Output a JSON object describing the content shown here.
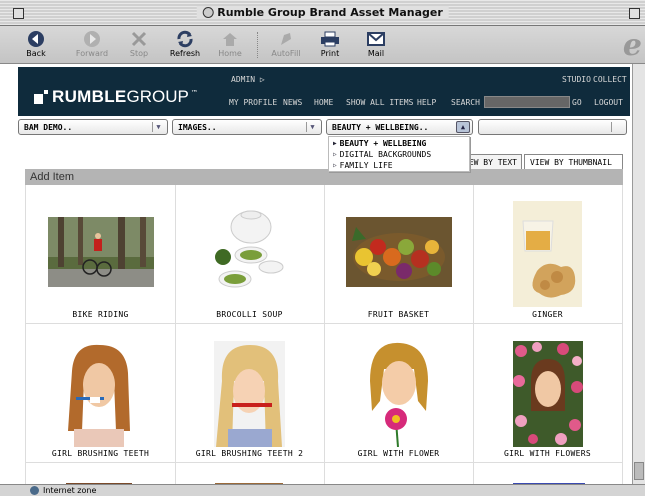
{
  "window": {
    "title": "Rumble Group Brand Asset Manager"
  },
  "toolbar": {
    "buttons": [
      {
        "label": "Back",
        "icon": "back-arrow-icon"
      },
      {
        "label": "Forward",
        "icon": "forward-arrow-icon"
      },
      {
        "label": "Stop",
        "icon": "stop-x-icon"
      },
      {
        "label": "Refresh",
        "icon": "refresh-icon"
      },
      {
        "label": "Home",
        "icon": "home-icon"
      },
      {
        "label": "AutoFill",
        "icon": "autofill-icon"
      },
      {
        "label": "Print",
        "icon": "printer-icon"
      },
      {
        "label": "Mail",
        "icon": "mail-icon"
      }
    ]
  },
  "header": {
    "logo_bold": "RUMBLE",
    "logo_light": "GROUP",
    "logo_tm": "™",
    "admin": "ADMIN",
    "nav": {
      "studio": "STUDIO",
      "collect": "COLLECT",
      "my_profile": "MY PROFILE",
      "news": "NEWS",
      "home": "HOME",
      "show_all": "SHOW ALL ITEMS",
      "help": "HELP",
      "search": "SEARCH",
      "go": "GO",
      "logout": "LOGOUT"
    }
  },
  "filters": {
    "client": "BAM DEMO..",
    "category": "IMAGES..",
    "subcategory": "BEAUTY + WELLBEING..",
    "fourth": ""
  },
  "dropdown_menu": {
    "items": [
      {
        "label": "BEAUTY + WELLBEING",
        "selected": true
      },
      {
        "label": "DIGITAL BACKGROUNDS",
        "selected": false
      },
      {
        "label": "FAMILY LIFE",
        "selected": false
      }
    ]
  },
  "view_tabs": {
    "text": "VIEW BY TEXT",
    "thumbnail": "VIEW BY THUMBNAIL"
  },
  "section": {
    "title": "Add Item"
  },
  "items": [
    {
      "caption": "BIKE RIDING"
    },
    {
      "caption": "BROCOLLI SOUP"
    },
    {
      "caption": "FRUIT BASKET"
    },
    {
      "caption": "GINGER"
    },
    {
      "caption": "GIRL BRUSHING TEETH"
    },
    {
      "caption": "GIRL BRUSHING TEETH 2"
    },
    {
      "caption": "GIRL WITH FLOWER"
    },
    {
      "caption": "GIRL WITH FLOWERS"
    }
  ],
  "status": {
    "zone": "Internet zone"
  }
}
